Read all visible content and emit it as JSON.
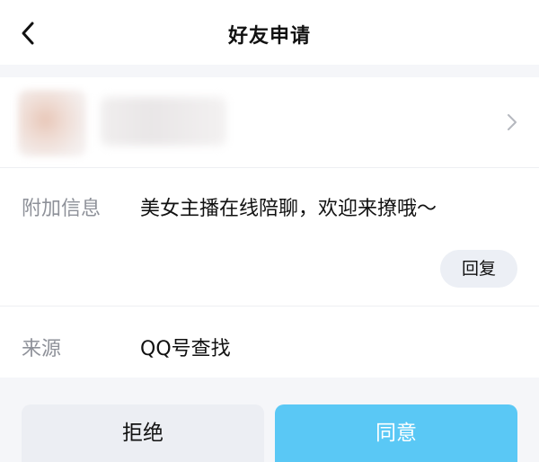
{
  "nav": {
    "title": "好友申请",
    "back_icon": "chevron-left-icon"
  },
  "profile": {
    "avatar_blurred": true,
    "name_blurred": true,
    "chevron_icon": "chevron-right-icon"
  },
  "extra_info": {
    "label": "附加信息",
    "value": "美女主播在线陪聊，欢迎来撩哦～",
    "reply_label": "回复"
  },
  "source": {
    "label": "来源",
    "value": "QQ号查找"
  },
  "actions": {
    "reject_label": "拒绝",
    "accept_label": "同意"
  },
  "colors": {
    "accept_bg": "#5ac8f5",
    "reject_bg": "#eceef3",
    "page_bg": "#f5f6f9"
  }
}
